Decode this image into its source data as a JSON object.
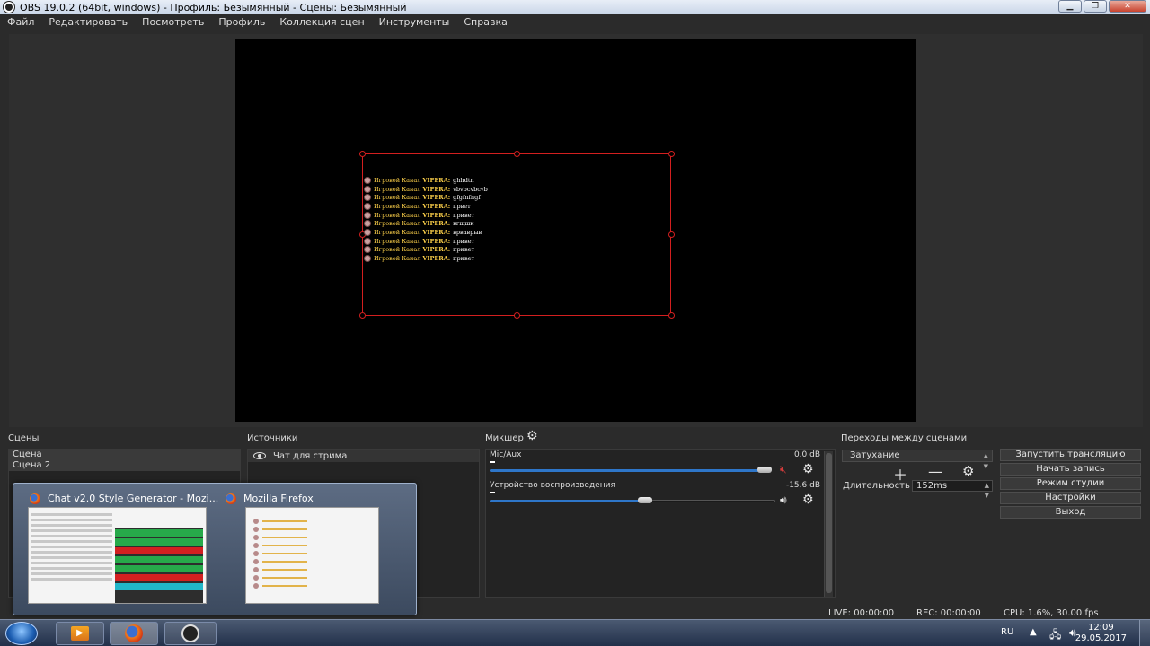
{
  "window": {
    "title": "OBS 19.0.2 (64bit, windows) - Профиль: Безымянный - Сцены: Безымянный"
  },
  "menu": [
    "Файл",
    "Редактировать",
    "Посмотреть",
    "Профиль",
    "Коллекция сцен",
    "Инструменты",
    "Справка"
  ],
  "preview": {
    "chat_lines": [
      {
        "name": "Игровой Канал",
        "tag": "VIPERA:",
        "msg": "ghhdtn"
      },
      {
        "name": "Игровой Канал",
        "tag": "VIPERA:",
        "msg": "vbvbcvbcvb"
      },
      {
        "name": "Игровой Канал",
        "tag": "VIPERA:",
        "msg": "gfgfnfngf"
      },
      {
        "name": "Игровой Канал",
        "tag": "VIPERA:",
        "msg": "првет"
      },
      {
        "name": "Игровой Канал",
        "tag": "VIPERA:",
        "msg": "привет"
      },
      {
        "name": "Игровой Канал",
        "tag": "VIPERA:",
        "msg": "вгщшн"
      },
      {
        "name": "Игровой Канал",
        "tag": "VIPERA:",
        "msg": "врваврыв"
      },
      {
        "name": "Игровой Канал",
        "tag": "VIPERA:",
        "msg": "привет"
      },
      {
        "name": "Игровой Канал",
        "tag": "VIPERA:",
        "msg": "привет"
      },
      {
        "name": "Игровой Канал",
        "tag": "VIPERA:",
        "msg": "привет"
      }
    ]
  },
  "scenes": {
    "label": "Сцены",
    "items": [
      "Сцена",
      "Сцена 2"
    ]
  },
  "sources": {
    "label": "Источники",
    "items": [
      "Чат для стрима"
    ]
  },
  "mixer": {
    "label": "Микшер",
    "tracks": [
      {
        "name": "Mic/Aux",
        "db": "0.0 dB",
        "level": 1.0,
        "muted": true
      },
      {
        "name": "Устройство воспроизведения",
        "db": "-15.6 dB",
        "level": 0.54,
        "muted": false
      }
    ]
  },
  "transitions": {
    "label": "Переходы между сценами",
    "selected": "Затухание",
    "duration_label": "Длительность",
    "duration_value": "152ms"
  },
  "controls": {
    "start_stream": "Запустить трансляцию",
    "start_record": "Начать запись",
    "studio_mode": "Режим студии",
    "settings": "Настройки",
    "exit": "Выход"
  },
  "status": {
    "live": "LIVE: 00:00:00",
    "rec": "REC: 00:00:00",
    "cpu": "CPU: 1.6%, 30.00 fps"
  },
  "popup": {
    "thumb1_title": "Chat v2.0 Style Generator - Mozi...",
    "thumb2_title": "Mozilla Firefox"
  },
  "taskbar": {
    "lang": "RU",
    "time": "12:09",
    "date": "29.05.2017"
  },
  "colors": {
    "accent": "#2e76c9",
    "selection": "#d31f1f",
    "chat_name": "#ffd24a"
  }
}
